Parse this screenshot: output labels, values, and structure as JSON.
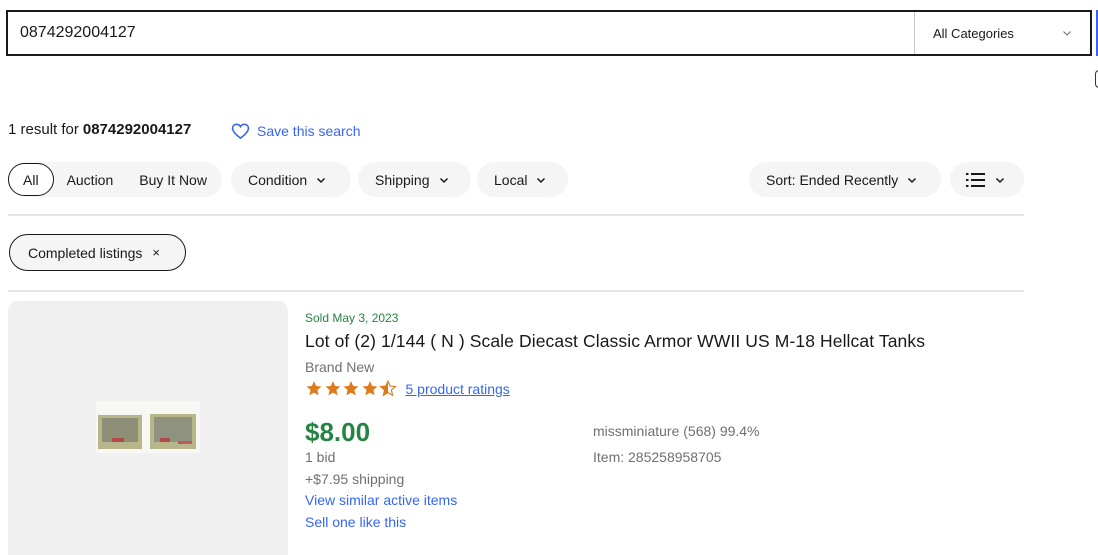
{
  "search": {
    "query": "0874292004127",
    "category": "All Categories"
  },
  "results": {
    "count_text": "1 result for",
    "query": "0874292004127",
    "save_search_label": "Save this search"
  },
  "filters": {
    "buying_format": [
      "All",
      "Auction",
      "Buy It Now"
    ],
    "selected_format": "All",
    "dropdowns": [
      "Condition",
      "Shipping",
      "Local"
    ],
    "sort_label": "Sort: Ended Recently",
    "view_icon": "list-view-icon",
    "active_chips": [
      {
        "label": "Completed listings",
        "remove": "×"
      }
    ]
  },
  "listing": {
    "sold_date": "Sold May 3, 2023",
    "title": "Lot of (2) 1/144 ( N ) Scale Diecast Classic Armor WWII US M-18 Hellcat Tanks",
    "condition": "Brand New",
    "rating_stars": 4.5,
    "rating_max": 5,
    "ratings_link": "5 product ratings",
    "price": "$8.00",
    "bids": "1 bid",
    "shipping": "+$7.95 shipping",
    "view_similar": "View similar active items",
    "sell_one": "Sell one like this",
    "seller": "missminiature (568) 99.4%",
    "item_number": "Item: 285258958705"
  },
  "colors": {
    "link_blue": "#3665f3",
    "sold_green": "#258442",
    "star_orange": "#dd7a1d",
    "muted_gray": "#707070"
  }
}
